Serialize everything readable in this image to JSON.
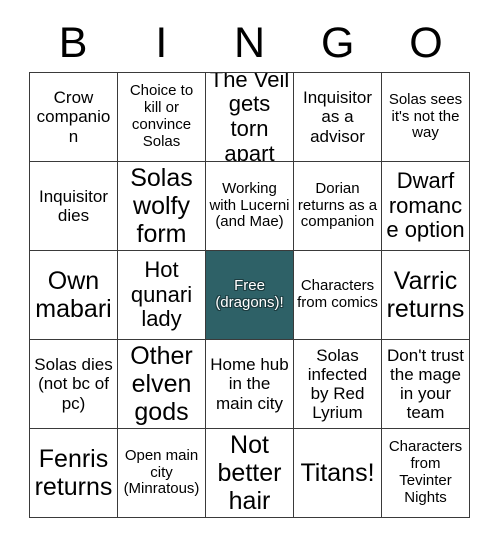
{
  "header": {
    "letters": [
      "B",
      "I",
      "N",
      "G",
      "O"
    ]
  },
  "colors": {
    "marked_fill": "#2e6167",
    "marked_text": "#ffffff",
    "grid_line": "#3a3a3a",
    "cell_fill": "#ffffff",
    "text": "#000000"
  },
  "grid": {
    "rows": 5,
    "columns": 5,
    "cells": [
      {
        "text": "Crow companion",
        "marked": false,
        "size": "md"
      },
      {
        "text": "Choice to kill or convince Solas",
        "marked": false,
        "size": "sm"
      },
      {
        "text": "The Veil gets torn apart",
        "marked": false,
        "size": "lg"
      },
      {
        "text": "Inquisitor as a advisor",
        "marked": false,
        "size": "md"
      },
      {
        "text": "Solas sees it's not the way",
        "marked": false,
        "size": "sm"
      },
      {
        "text": "Inquisitor dies",
        "marked": false,
        "size": "md"
      },
      {
        "text": "Solas wolfy form",
        "marked": false,
        "size": "xl"
      },
      {
        "text": "Working with Lucerni (and Mae)",
        "marked": false,
        "size": "sm"
      },
      {
        "text": "Dorian returns as a companion",
        "marked": false,
        "size": "sm"
      },
      {
        "text": "Dwarf romance option",
        "marked": false,
        "size": "lg"
      },
      {
        "text": "Own mabari",
        "marked": false,
        "size": "xl"
      },
      {
        "text": "Hot qunari lady",
        "marked": false,
        "size": "lg"
      },
      {
        "text": "Free (dragons)!",
        "marked": true,
        "size": "sm"
      },
      {
        "text": "Characters from comics",
        "marked": false,
        "size": "sm"
      },
      {
        "text": "Varric returns",
        "marked": false,
        "size": "xl"
      },
      {
        "text": "Solas dies (not bc of pc)",
        "marked": false,
        "size": "md"
      },
      {
        "text": "Other elven gods",
        "marked": false,
        "size": "xl"
      },
      {
        "text": "Home hub in the main city",
        "marked": false,
        "size": "md"
      },
      {
        "text": "Solas infected by Red Lyrium",
        "marked": false,
        "size": "md"
      },
      {
        "text": "Don't trust the mage in your team",
        "marked": false,
        "size": "md"
      },
      {
        "text": "Fenris returns",
        "marked": false,
        "size": "xl"
      },
      {
        "text": "Open main city (Minratous)",
        "marked": false,
        "size": "sm"
      },
      {
        "text": "Not better hair",
        "marked": false,
        "size": "xl"
      },
      {
        "text": "Titans!",
        "marked": false,
        "size": "xl"
      },
      {
        "text": "Characters from Tevinter Nights",
        "marked": false,
        "size": "sm"
      }
    ]
  }
}
